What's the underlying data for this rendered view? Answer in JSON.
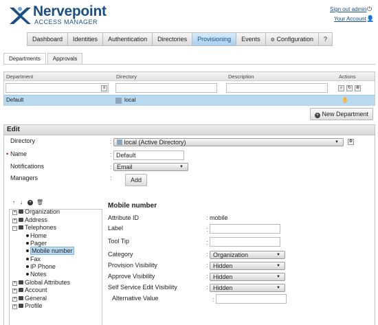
{
  "app": {
    "title": "Nervepoint",
    "subtitle": "ACCESS MANAGER",
    "sign_out": "Sign out admin",
    "your_account": "Your Account"
  },
  "main_nav": [
    "Dashboard",
    "Identities",
    "Authentication",
    "Directories",
    "Provisioning",
    "Events",
    "Configuration",
    "?"
  ],
  "sub_tabs": [
    "Departments",
    "Approvals"
  ],
  "dept_table": {
    "headers": {
      "department": "Department",
      "directory": "Directory",
      "description": "Description",
      "actions": "Actions"
    },
    "rows": [
      {
        "department": "Default",
        "directory": "local",
        "description": ""
      }
    ]
  },
  "new_department": "New Department",
  "edit": {
    "title": "Edit",
    "directory_label": "Directory",
    "directory_value": "local (Active Directory)",
    "name_label": "Name",
    "name_value": "Default",
    "notifications_label": "Notifications",
    "notifications_value": "Email",
    "managers_label": "Managers",
    "add_label": "Add"
  },
  "tree": [
    {
      "label": "Organization",
      "kind": "folder",
      "expanded": false,
      "level": 0
    },
    {
      "label": "Address",
      "kind": "folder",
      "expanded": false,
      "level": 0
    },
    {
      "label": "Telephones",
      "kind": "folder",
      "expanded": true,
      "level": 0
    },
    {
      "label": "Home",
      "kind": "leaf",
      "level": 1
    },
    {
      "label": "Pager",
      "kind": "leaf",
      "level": 1
    },
    {
      "label": "Mobile number",
      "kind": "leaf",
      "level": 1,
      "selected": true
    },
    {
      "label": "Fax",
      "kind": "leaf",
      "level": 1
    },
    {
      "label": "IP Phone",
      "kind": "leaf",
      "level": 1
    },
    {
      "label": "Notes",
      "kind": "leaf",
      "level": 1
    },
    {
      "label": "Global Attributes",
      "kind": "folder",
      "expanded": false,
      "level": 0
    },
    {
      "label": "Account",
      "kind": "folder",
      "expanded": false,
      "level": 0
    },
    {
      "label": "General",
      "kind": "folder",
      "expanded": false,
      "level": 0
    },
    {
      "label": "Profile",
      "kind": "folder",
      "expanded": false,
      "level": 0
    }
  ],
  "attribute": {
    "heading": "Mobile number",
    "id_label": "Attribute ID",
    "id_value": "mobile",
    "label_label": "Label",
    "label_value": "",
    "tooltip_label": "Tool Tip",
    "tooltip_value": "",
    "category_label": "Category",
    "category_value": "Organization",
    "prov_vis_label": "Provision Visibility",
    "prov_vis_value": "Hidden",
    "appr_vis_label": "Approve Visibility",
    "appr_vis_value": "Hidden",
    "ss_vis_label": "Self Service Edit Visibility",
    "ss_vis_value": "Hidden",
    "alt_label": "Alternative Value",
    "alt_value": ""
  },
  "colors": {
    "brand": "#1a4f86",
    "accent_tab": "#a9d1ef",
    "selected_row": "#b9d9f0"
  }
}
